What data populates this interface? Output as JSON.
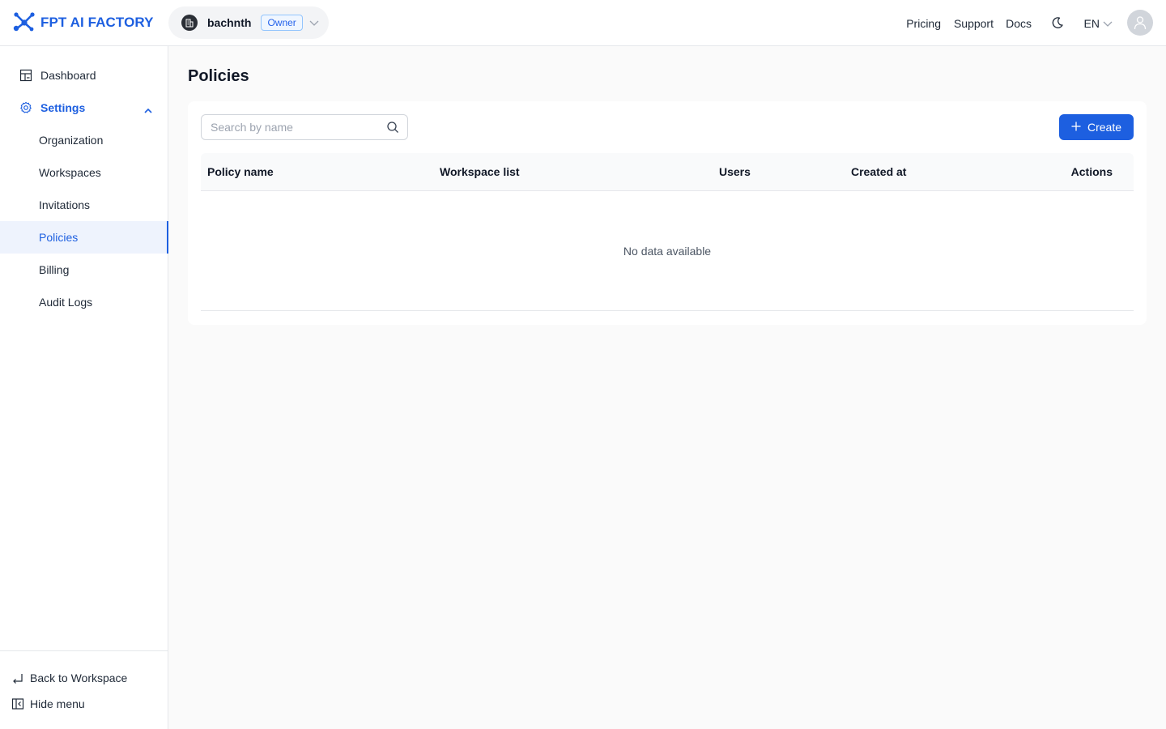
{
  "brand": {
    "name": "FPT AI FACTORY",
    "color": "#1d5fe0"
  },
  "org": {
    "name": "bachnth",
    "role": "Owner"
  },
  "top_nav": {
    "pricing": "Pricing",
    "support": "Support",
    "docs": "Docs",
    "language": "EN"
  },
  "sidebar": {
    "dashboard": "Dashboard",
    "settings": "Settings",
    "items": [
      "Organization",
      "Workspaces",
      "Invitations",
      "Policies",
      "Billing",
      "Audit Logs"
    ],
    "active_item": "Policies",
    "back_to_workspace": "Back to Workspace",
    "hide_menu": "Hide menu"
  },
  "page": {
    "title": "Policies",
    "search_placeholder": "Search by name",
    "create_label": "Create",
    "table": {
      "columns": [
        "Policy name",
        "Workspace list",
        "Users",
        "Created at",
        "Actions"
      ],
      "rows": [],
      "empty_text": "No data available"
    }
  },
  "icons": {
    "logo": "network-nodes-icon",
    "theme": "moon-icon",
    "search": "search-icon",
    "create": "plus-icon"
  }
}
